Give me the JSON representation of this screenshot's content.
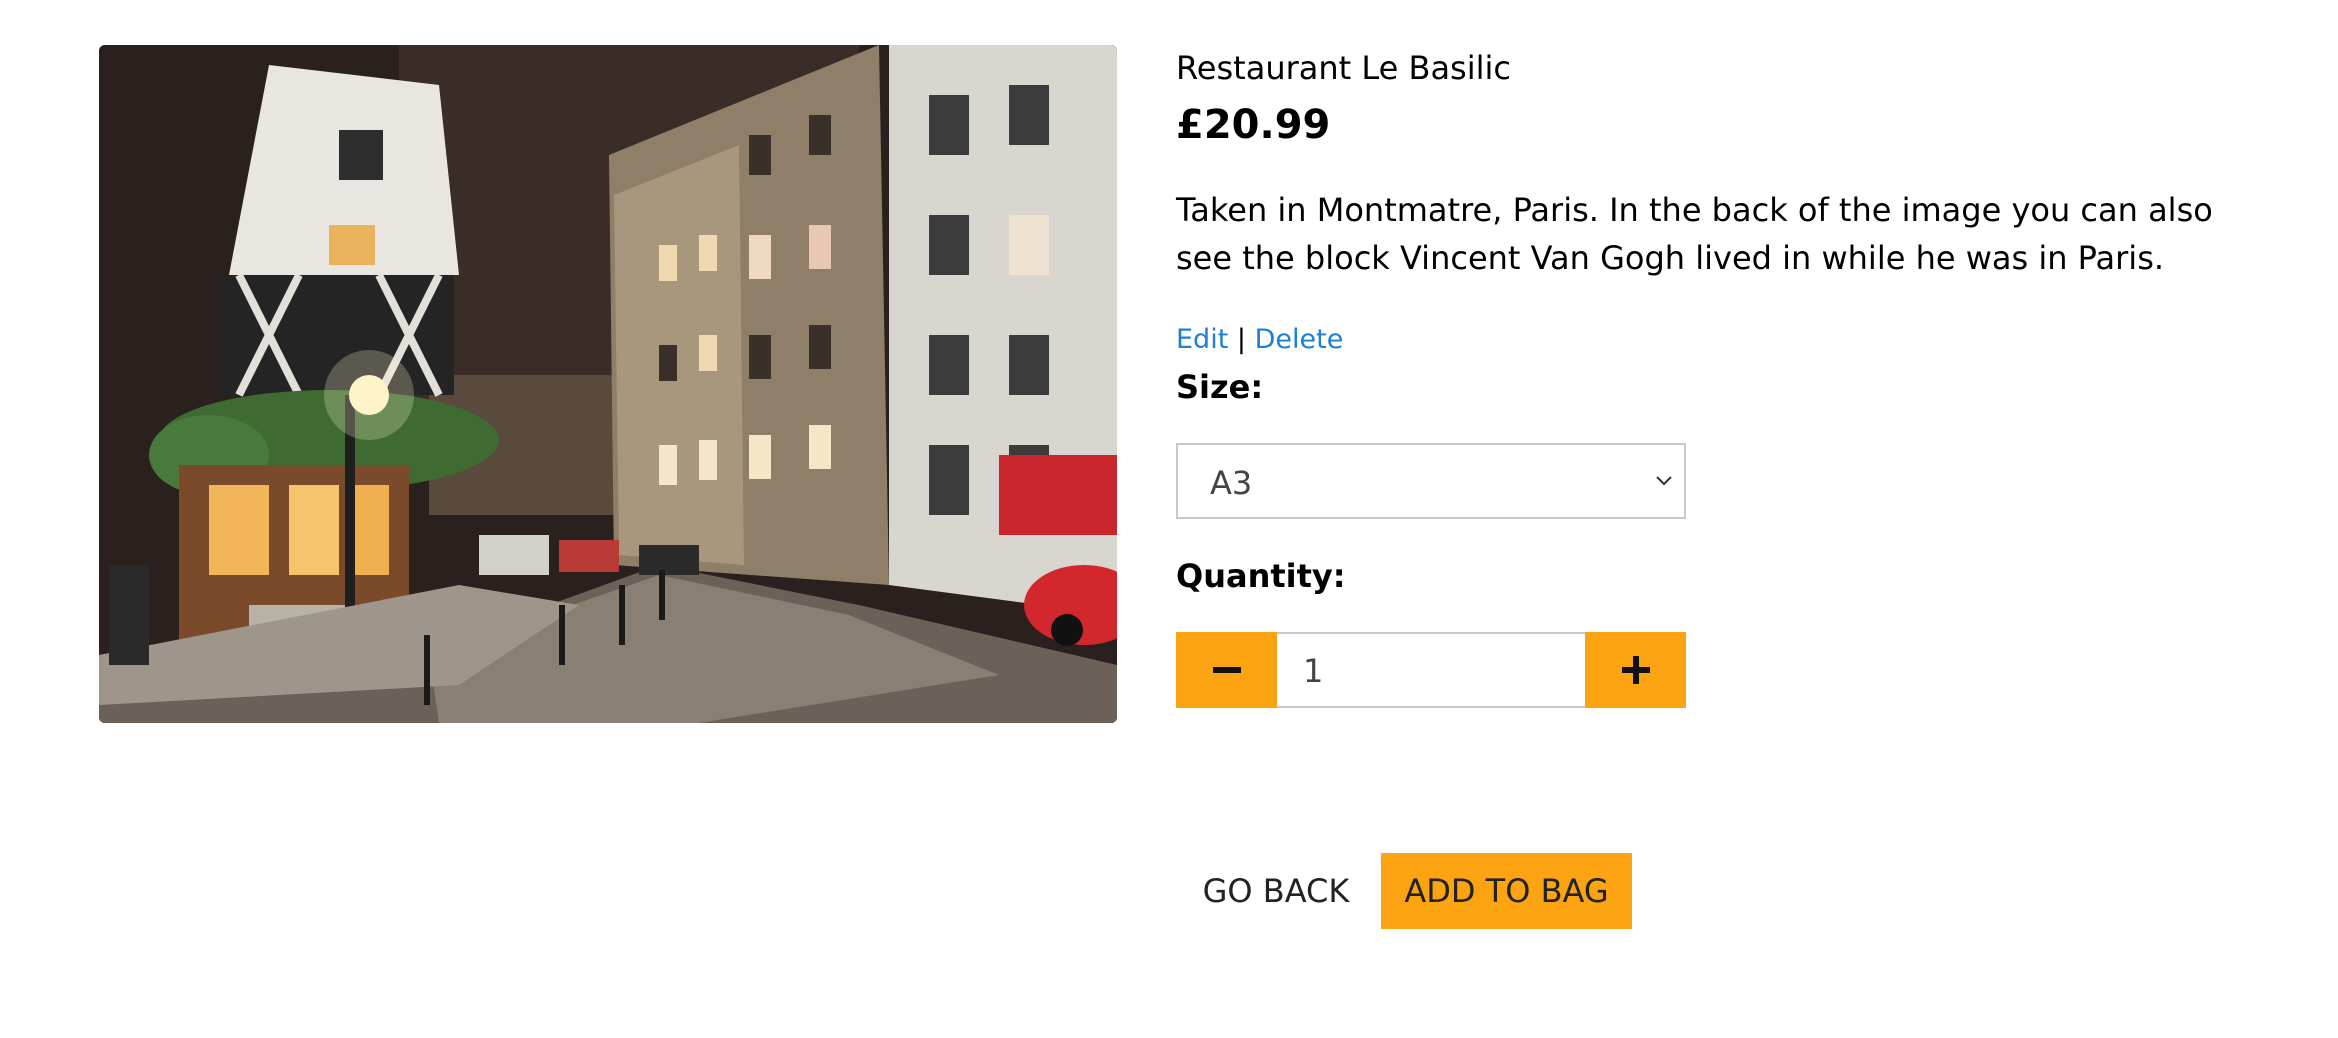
{
  "product": {
    "name": "Restaurant Le Basilic",
    "price": "£20.99",
    "description": "Taken in Montmatre, Paris. In the back of the image you can also see the block Vincent Van Gogh lived in while he was in Paris."
  },
  "admin": {
    "edit_label": "Edit",
    "separator": "|",
    "delete_label": "Delete"
  },
  "size": {
    "label": "Size:",
    "selected": "A3"
  },
  "quantity": {
    "label": "Quantity:",
    "value": "1"
  },
  "actions": {
    "go_back_label": "GO BACK",
    "add_to_bag_label": "ADD TO BAG"
  },
  "colors": {
    "accent": "#fca311",
    "link": "#1e7fd4"
  },
  "icons": {
    "minus": "minus-icon",
    "plus": "plus-icon",
    "dropdown": "chevron-down-icon"
  }
}
